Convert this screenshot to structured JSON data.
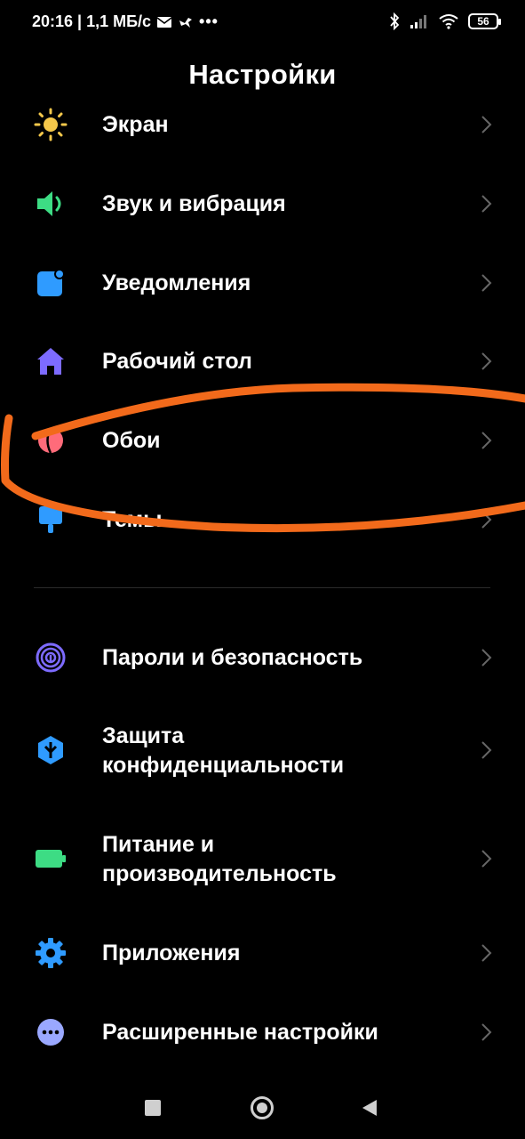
{
  "status_bar": {
    "time_speed": "20:16 | 1,1 МБ/с",
    "battery": "56",
    "more": "•••"
  },
  "header": {
    "title": "Настройки"
  },
  "items": [
    {
      "label": "Экран",
      "icon": "sun-icon",
      "color": "#F5C84B"
    },
    {
      "label": "Звук и вибрация",
      "icon": "speaker-icon",
      "color": "#3DDC84"
    },
    {
      "label": "Уведомления",
      "icon": "notification-icon",
      "color": "#2F9BFF"
    },
    {
      "label": "Рабочий стол",
      "icon": "home-icon",
      "color": "#7D6BFF"
    },
    {
      "label": "Обои",
      "icon": "wallpaper-icon",
      "color": "#FF6B7A"
    },
    {
      "label": "Темы",
      "icon": "brush-icon",
      "color": "#2F9BFF"
    },
    {
      "label": "Пароли и безопасность",
      "icon": "fingerprint-icon",
      "color": "#7D6BFF"
    },
    {
      "label_line1": "Защита",
      "label_line2": "конфиденциальности",
      "icon": "privacy-shield-icon",
      "color": "#2F9BFF"
    },
    {
      "label_line1": "Питание и",
      "label_line2": "производительность",
      "icon": "battery-icon",
      "color": "#3DDC84"
    },
    {
      "label": "Приложения",
      "icon": "gear-icon",
      "color": "#2F9BFF"
    },
    {
      "label": "Расширенные настройки",
      "icon": "more-dots-icon",
      "color": "#9AA8FF"
    }
  ],
  "annotation": {
    "color": "#F26A1B"
  }
}
